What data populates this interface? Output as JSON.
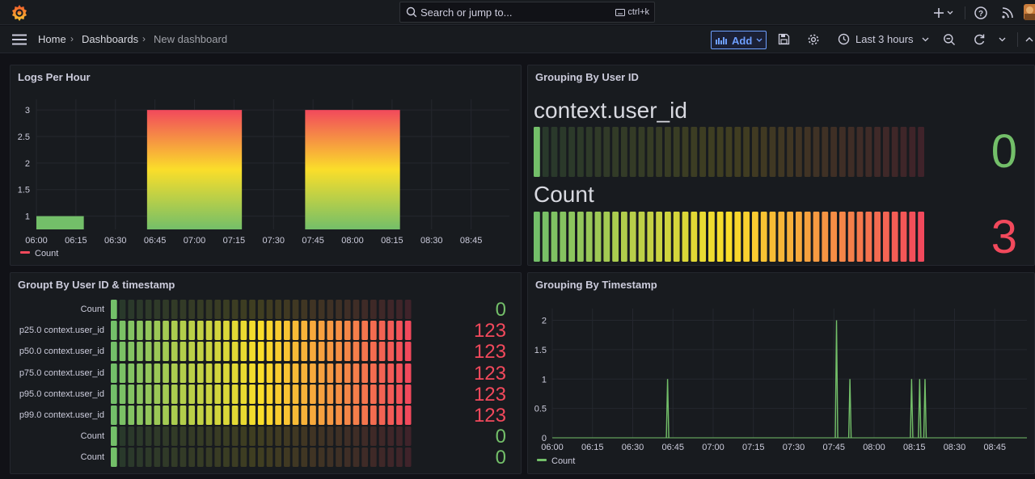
{
  "topbar": {
    "search_placeholder": "Search or jump to...",
    "shortcut": "ctrl+k"
  },
  "breadcrumb": {
    "home": "Home",
    "dashboards": "Dashboards",
    "current": "New dashboard"
  },
  "toolbar": {
    "add_label": "Add",
    "time_range": "Last 3 hours"
  },
  "colors": {
    "green": "#73bf69",
    "yellow": "#fade2a",
    "red": "#f2495c",
    "blue": "#6e9fff"
  },
  "panels": {
    "logs_per_hour": {
      "title": "Logs Per Hour",
      "legend": "Count",
      "chart_data": {
        "type": "bar",
        "x_ticks": [
          "06:00",
          "06:15",
          "06:30",
          "06:45",
          "07:00",
          "07:15",
          "07:30",
          "07:45",
          "08:00",
          "08:15",
          "08:30",
          "08:45"
        ],
        "y_ticks": [
          "1",
          "1.5",
          "2",
          "2.5",
          "3"
        ],
        "ylim": [
          0.75,
          3.2
        ],
        "bars": [
          {
            "start": "06:00",
            "end": "06:18",
            "value": 1
          },
          {
            "start": "06:42",
            "end": "07:18",
            "value": 3
          },
          {
            "start": "07:42",
            "end": "08:18",
            "value": 3
          }
        ],
        "series": [
          {
            "name": "Count"
          }
        ]
      }
    },
    "grouping_user_id": {
      "title": "Grouping By User ID",
      "rows": [
        {
          "label": "context.user_id",
          "value": "0",
          "fill": 0.0
        },
        {
          "label": "Count",
          "value": "3",
          "fill": 1.0
        }
      ]
    },
    "group_user_ts": {
      "title": "Groupt By User ID & timestamp",
      "rows": [
        {
          "label": "Count",
          "value": "0",
          "fill": 0.0
        },
        {
          "label": "p25.0 context.user_id",
          "value": "123",
          "fill": 1.0
        },
        {
          "label": "p50.0 context.user_id",
          "value": "123",
          "fill": 1.0
        },
        {
          "label": "p75.0 context.user_id",
          "value": "123",
          "fill": 1.0
        },
        {
          "label": "p95.0 context.user_id",
          "value": "123",
          "fill": 1.0
        },
        {
          "label": "p99.0 context.user_id",
          "value": "123",
          "fill": 1.0
        },
        {
          "label": "Count",
          "value": "0",
          "fill": 0.0
        },
        {
          "label": "Count",
          "value": "0",
          "fill": 0.0
        }
      ]
    },
    "grouping_ts": {
      "title": "Grouping By Timestamp",
      "legend": "Count",
      "chart_data": {
        "type": "line",
        "x_ticks": [
          "06:00",
          "06:15",
          "06:30",
          "06:45",
          "07:00",
          "07:15",
          "07:30",
          "07:45",
          "08:00",
          "08:15",
          "08:30",
          "08:45"
        ],
        "y_ticks": [
          "0",
          "0.5",
          "1",
          "1.5",
          "2"
        ],
        "ylim": [
          0,
          2.2
        ],
        "xlim": [
          "06:00",
          "08:57"
        ],
        "spikes": [
          {
            "time": "06:43",
            "value": 1
          },
          {
            "time": "07:46",
            "value": 2
          },
          {
            "time": "07:51",
            "value": 1
          },
          {
            "time": "08:14",
            "value": 1
          },
          {
            "time": "08:17",
            "value": 1
          },
          {
            "time": "08:19",
            "value": 1
          }
        ],
        "series": [
          {
            "name": "Count"
          }
        ]
      }
    }
  }
}
